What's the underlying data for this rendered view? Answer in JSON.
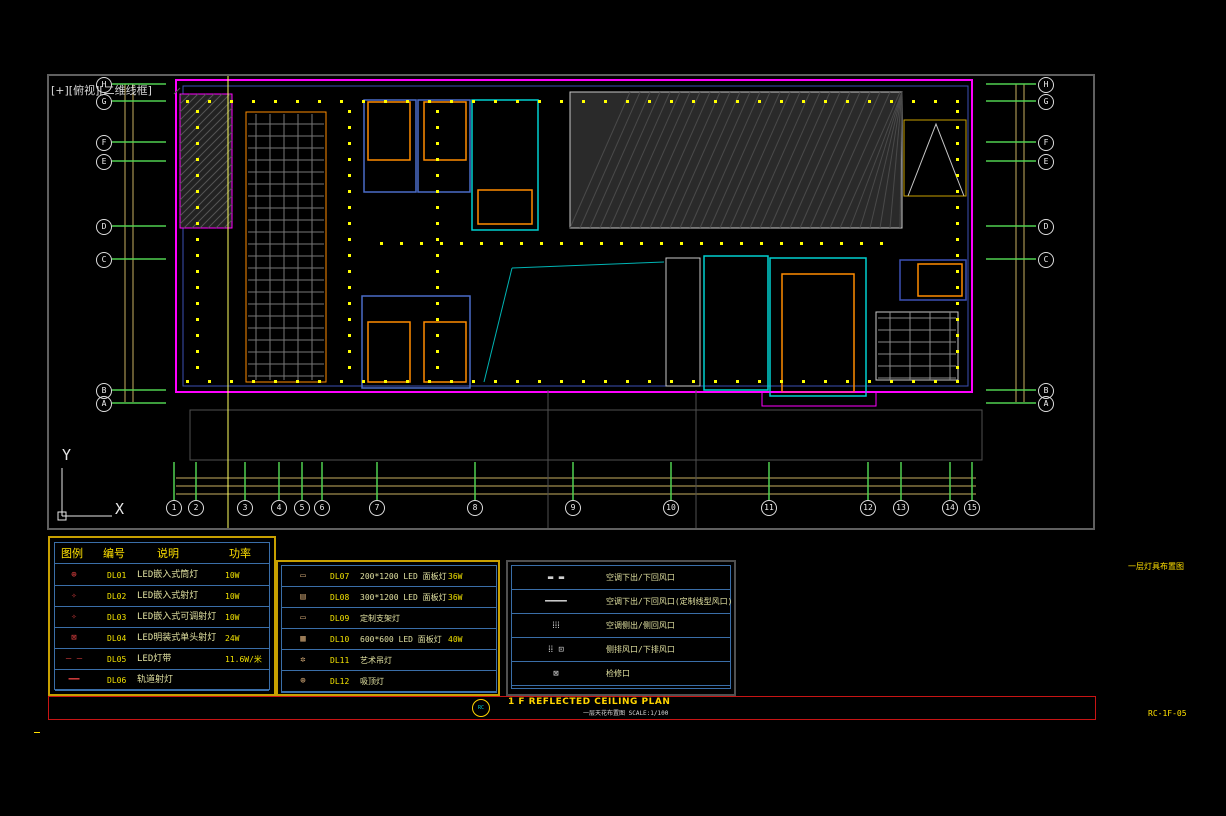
{
  "viewport": {
    "label": "[+][俯视][二维线框]"
  },
  "grid": {
    "cols": [
      "1",
      "2",
      "3",
      "4",
      "5",
      "6",
      "7",
      "8",
      "9",
      "10",
      "11",
      "12",
      "13",
      "14",
      "15"
    ],
    "rows": [
      "H",
      "G",
      "F",
      "E",
      "D",
      "C",
      "B",
      "A"
    ]
  },
  "ucs": {
    "x": "X",
    "y": "Y"
  },
  "legend1": {
    "headers": [
      "图例",
      "编号",
      "说明",
      "功率"
    ],
    "rows": [
      {
        "code": "DL01",
        "desc": "LED嵌入式筒灯",
        "power": "10W"
      },
      {
        "code": "DL02",
        "desc": "LED嵌入式射灯",
        "power": "10W"
      },
      {
        "code": "DL03",
        "desc": "LED嵌入式可调射灯",
        "power": "10W"
      },
      {
        "code": "DL04",
        "desc": "LED明装式单头射灯",
        "power": "24W"
      },
      {
        "code": "DL05",
        "desc": "LED灯带",
        "power": "11.6W/米"
      },
      {
        "code": "DL06",
        "desc": "轨道射灯",
        "power": ""
      }
    ]
  },
  "legend2": {
    "rows": [
      {
        "code": "DL07",
        "desc": "200*1200 LED 面板灯",
        "power": "36W"
      },
      {
        "code": "DL08",
        "desc": "300*1200 LED 面板灯",
        "power": "36W"
      },
      {
        "code": "DL09",
        "desc": "定制支架灯",
        "power": ""
      },
      {
        "code": "DL10",
        "desc": "600*600 LED 面板灯",
        "power": "40W"
      },
      {
        "code": "DL11",
        "desc": "艺术吊灯",
        "power": ""
      },
      {
        "code": "DL12",
        "desc": "吸顶灯",
        "power": ""
      }
    ]
  },
  "legend3": {
    "rows": [
      {
        "desc": "空调下出/下回风口"
      },
      {
        "desc": "空调下出/下回风口(定制线型风口)"
      },
      {
        "desc": "空调侧出/侧回风口"
      },
      {
        "desc": "侧排风口/下排风口"
      },
      {
        "desc": "检修口"
      }
    ]
  },
  "title": {
    "main": "1 F REFLECTED CEILING PLAN",
    "sub": "一层天花布置图   SCALE:1/100",
    "badge": "RC"
  },
  "side_notes": {
    "right_title": "一层灯具布置图",
    "sheet": "RC-1F-05"
  },
  "colors": {
    "cad_yellow": "#ffff00",
    "cad_magenta": "#ff00ff",
    "cad_cyan": "#00ffff",
    "cad_orange": "#ff8c00",
    "cad_green": "#00ff00",
    "cad_red": "#c81414"
  }
}
